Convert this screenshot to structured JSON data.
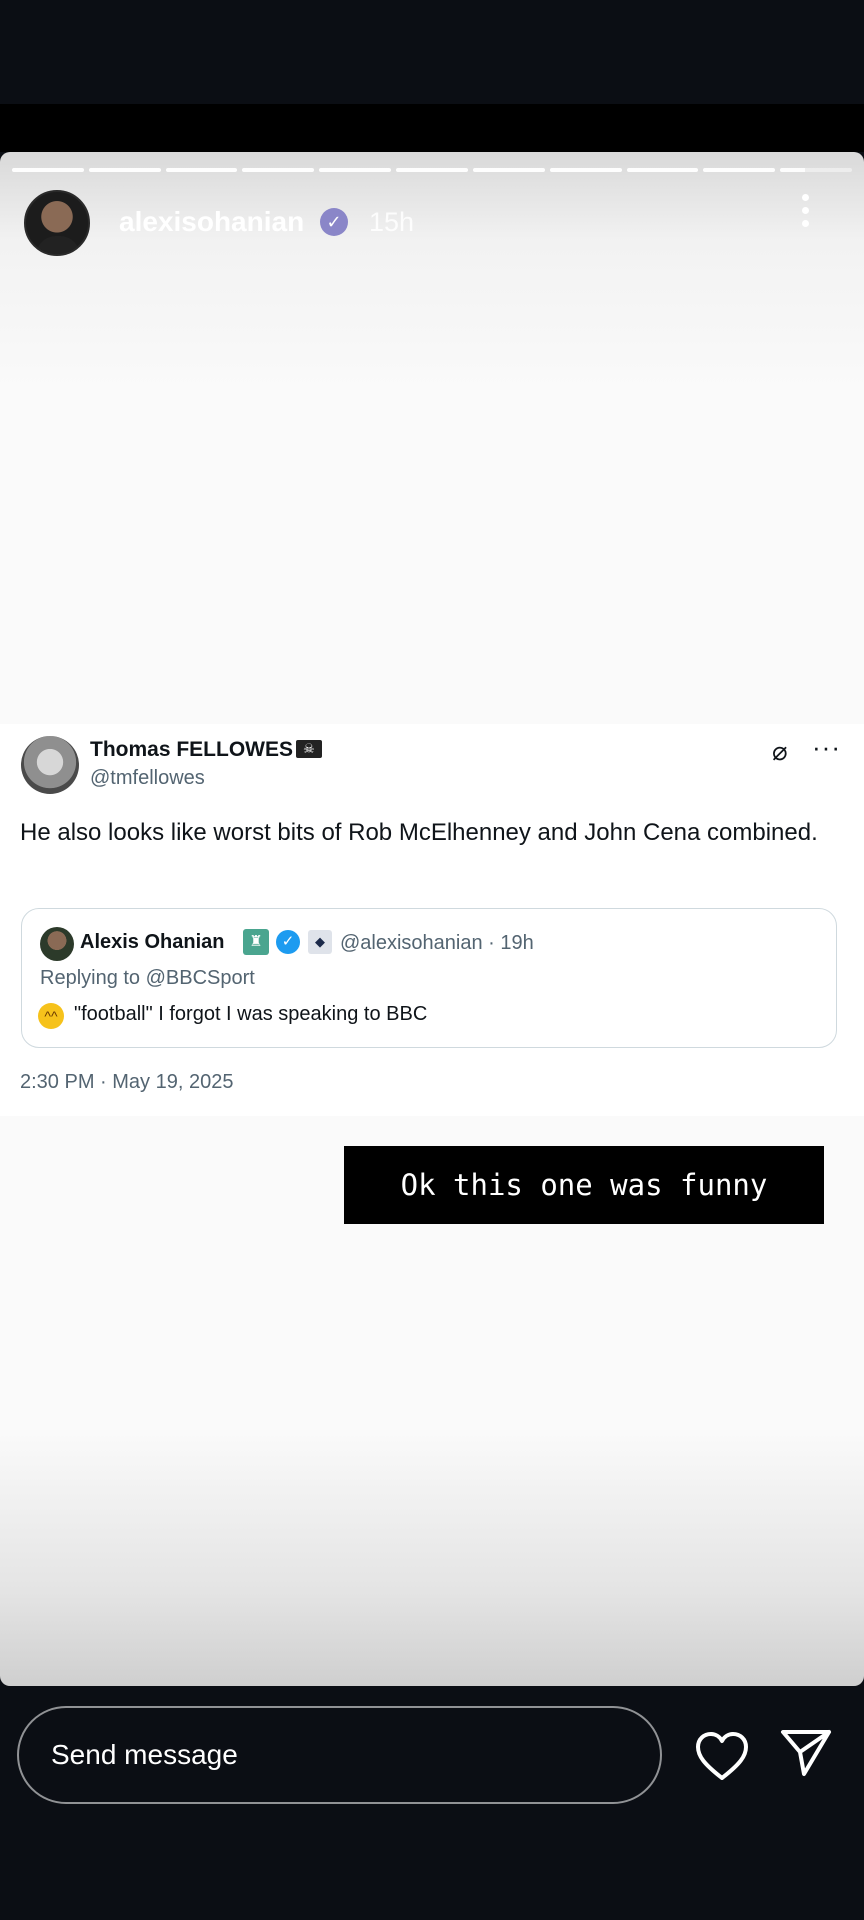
{
  "story": {
    "username": "alexisohanian",
    "time": "15h",
    "progress_segments": 11,
    "caption": "Ok this one was funny"
  },
  "tweet": {
    "author_name": "Thomas FELLOWES",
    "author_handle": "@tmfellowes",
    "text": "He also looks like worst bits of Rob McElhenney and John Cena combined.",
    "timestamp": "2:30 PM · May 19, 2025",
    "quote": {
      "author_name": "Alexis Ohanian",
      "author_meta": "@alexisohanian · 19h",
      "replying_to": "Replying to @BBCSport",
      "text": "\"football\" I forgot I was speaking to BBC"
    }
  },
  "bottom": {
    "message_placeholder": "Send message"
  },
  "icons": {
    "verified": "verified-badge-icon",
    "more": "more-vertical-icon",
    "like": "heart-icon",
    "share": "send-icon"
  },
  "colors": {
    "story_verified": "#8a86c8",
    "twitter_verified": "#1d9bf0",
    "background": "#0b0e14"
  }
}
